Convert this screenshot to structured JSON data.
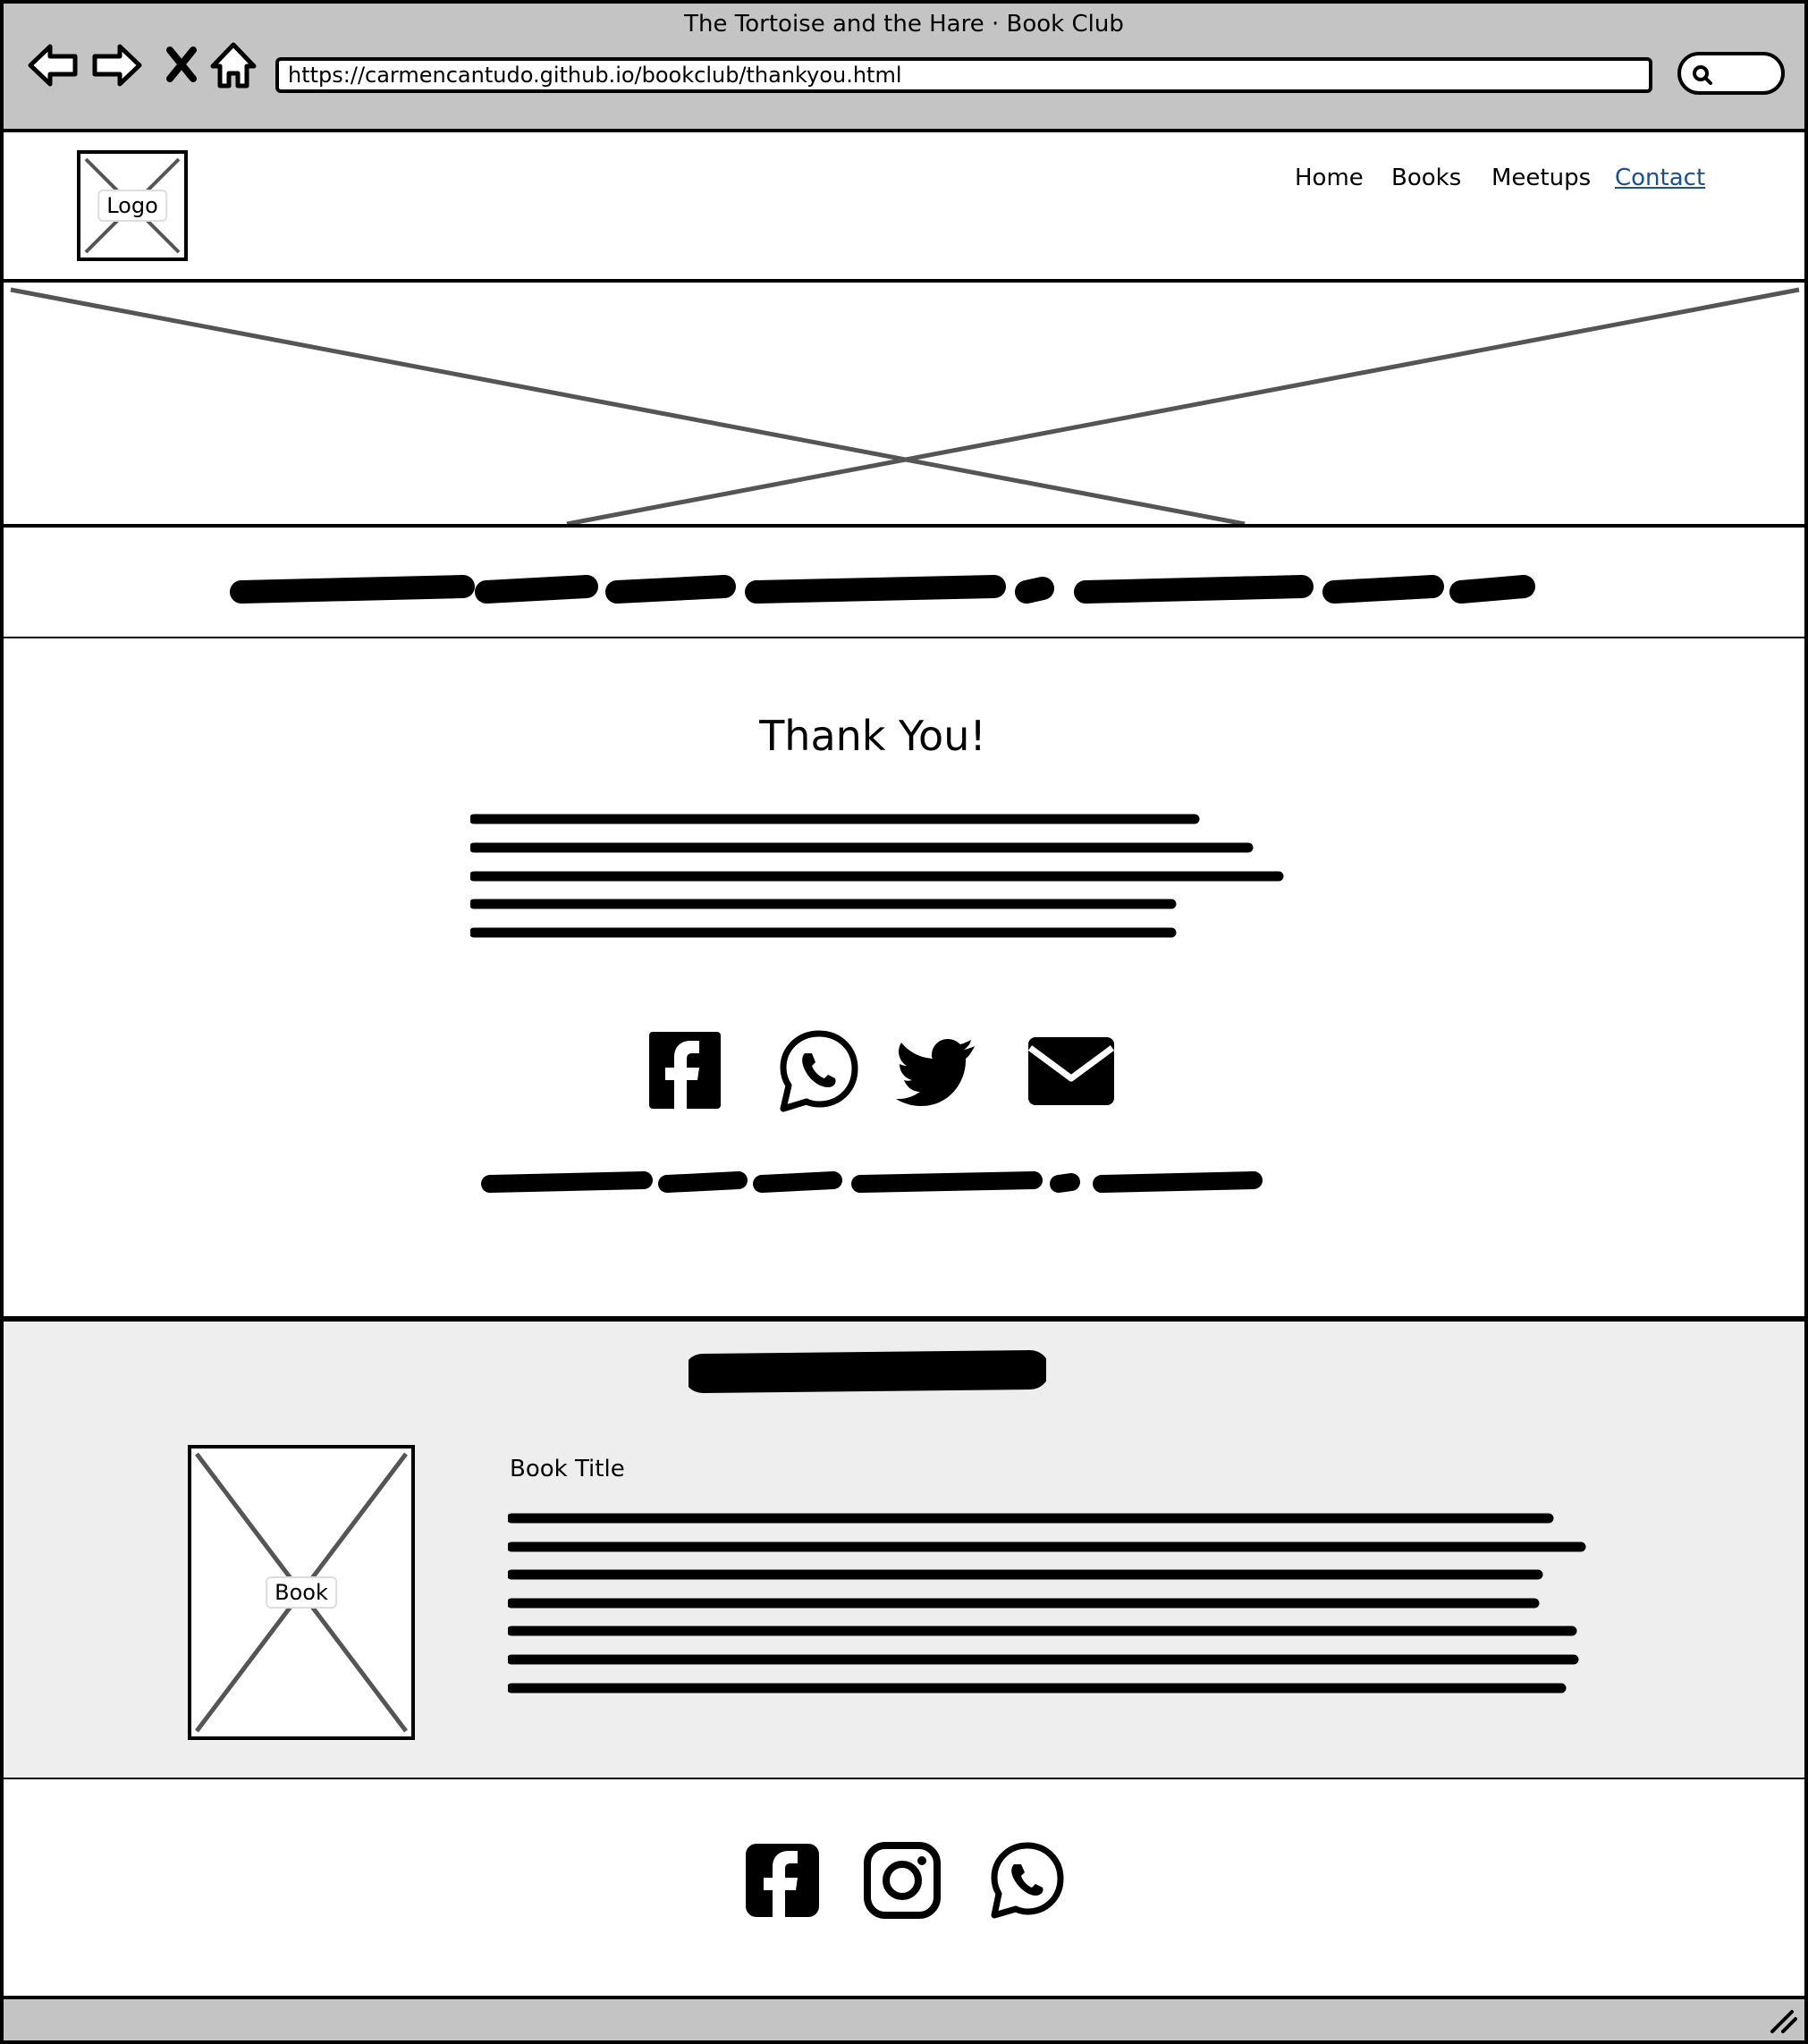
{
  "browser": {
    "window_title": "The Tortoise and the Hare · Book Club",
    "url": "https://carmencantudo.github.io/bookclub/thankyou.html",
    "buttons": [
      "back-arrow-icon",
      "forward-arrow-icon",
      "close-x-icon",
      "home-icon"
    ]
  },
  "header": {
    "logo_label": "Logo",
    "nav": [
      "Home",
      "Books",
      "Meetups",
      "Contact"
    ],
    "active_nav": "Contact",
    "active_color": "#1b4f8f"
  },
  "main": {
    "title": "Thank You!",
    "share_icons": [
      "facebook-icon",
      "whatsapp-icon",
      "twitter-icon",
      "mail-icon"
    ]
  },
  "featured": {
    "image_label": "Book",
    "book_title": "Book Title",
    "background": "#eeeeee"
  },
  "footer": {
    "social_icons": [
      "facebook-icon",
      "instagram-icon",
      "whatsapp-icon"
    ]
  },
  "colors": {
    "chrome": "#c4c4c4",
    "placeholder_cross": "#555555"
  }
}
